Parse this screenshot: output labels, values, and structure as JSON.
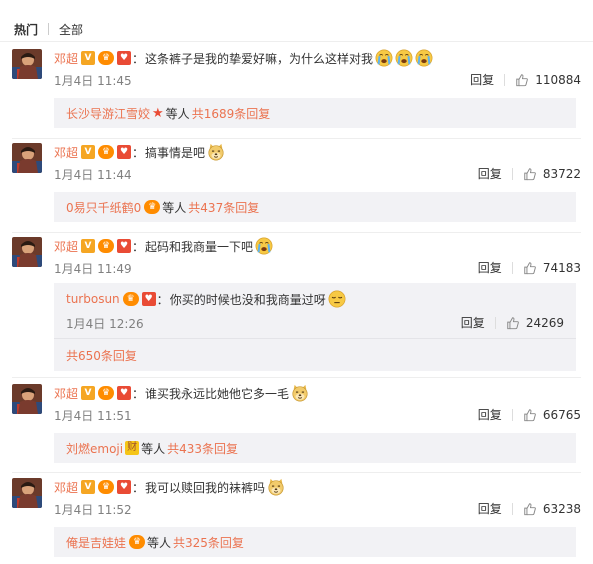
{
  "tabs": {
    "hot": "热门",
    "all": "全部"
  },
  "labels": {
    "reply": "回复",
    "people_suffix": "等人",
    "total_prefix": "共",
    "reply_suffix": "条回复"
  },
  "colors": {
    "accent": "#eb7350",
    "summary_bg": "#f2f2f5"
  },
  "comments": [
    {
      "user": "邓超",
      "separator": "：",
      "text": "这条裤子是我的挚爱好嘛，为什么这样对我",
      "emojis": [
        "crying-emoji",
        "crying-emoji",
        "crying-emoji"
      ],
      "time": "1月4日 11:45",
      "likes": "110884",
      "summary": {
        "name": "长沙导游江雪姣",
        "badge": "star-badge-icon",
        "count_text": "共1689条回复"
      }
    },
    {
      "user": "邓超",
      "separator": "：",
      "text": "搞事情是吧",
      "emojis": [
        "doge-emoji"
      ],
      "time": "1月4日 11:44",
      "likes": "83722",
      "summary": {
        "name": "0易只千纸鹤0",
        "badge": "vip-badge-icon",
        "count_text": "共437条回复"
      }
    },
    {
      "user": "邓超",
      "separator": "：",
      "text": "起码和我商量一下吧",
      "emojis": [
        "crying-emoji"
      ],
      "time": "1月4日 11:49",
      "likes": "74183",
      "sub_reply": {
        "user": "turbosun",
        "separator": "：",
        "text": "你买的时候也没和我商量过呀",
        "emojis": [
          "sigh-emoji"
        ],
        "time": "1月4日 12:26",
        "likes": "24269"
      },
      "more_text": "共650条回复"
    },
    {
      "user": "邓超",
      "separator": "：",
      "text": "谁买我永远比她他它多一毛",
      "emojis": [
        "doge-emoji"
      ],
      "time": "1月4日 11:51",
      "likes": "66765",
      "summary": {
        "name": "刘燃emoji",
        "badge_text": "财",
        "badge": "cai-badge-icon",
        "count_text": "共433条回复"
      }
    },
    {
      "user": "邓超",
      "separator": "：",
      "text": "我可以赎回我的袜裤吗",
      "emojis": [
        "doge-emoji"
      ],
      "time": "1月4日 11:52",
      "likes": "63238",
      "summary": {
        "name": "俺是吉娃娃",
        "badge": "vip-badge-icon",
        "count_text": "共325条回复"
      }
    }
  ]
}
